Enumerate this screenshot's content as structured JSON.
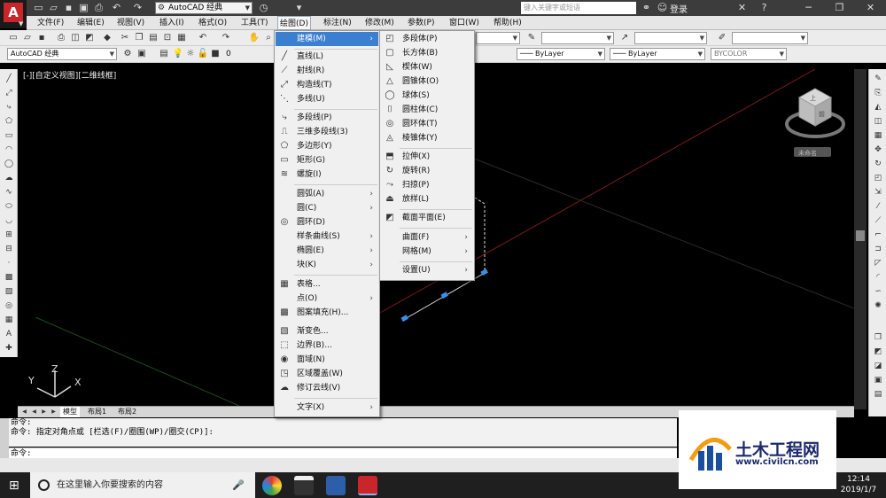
{
  "app": {
    "workspace": "AutoCAD 经典",
    "search_placeholder": "键入关键字或短语",
    "login": "登录"
  },
  "menubar": [
    "文件(F)",
    "编辑(E)",
    "视图(V)",
    "插入(I)",
    "格式(O)",
    "工具(T)",
    "绘图(D)",
    "标注(N)",
    "修改(M)",
    "参数(P)",
    "窗口(W)",
    "帮助(H)"
  ],
  "toolbar": {
    "workspace_combo": "AutoCAD 经典",
    "layer": "0",
    "linetype1": "ByLayer",
    "linetype2": "ByLayer",
    "color": "BYCOLOR"
  },
  "viewport": {
    "label": "[-][自定义视图][二维线框]",
    "viewcube_top": "上",
    "viewcube_front": "前",
    "unnamed": "未命名"
  },
  "draw_menu": {
    "items": [
      "建模(M)",
      "直线(L)",
      "射线(R)",
      "构造线(T)",
      "多线(U)",
      "多段线(P)",
      "三维多段线(3)",
      "多边形(Y)",
      "矩形(G)",
      "螺旋(I)",
      "圆弧(A)",
      "圆(C)",
      "圆环(D)",
      "样条曲线(S)",
      "椭圆(E)",
      "块(K)",
      "表格...",
      "点(O)",
      "图案填充(H)...",
      "渐变色...",
      "边界(B)...",
      "面域(N)",
      "区域覆盖(W)",
      "修订云线(V)",
      "文字(X)"
    ]
  },
  "modeling_menu": {
    "items": [
      "多段体(P)",
      "长方体(B)",
      "楔体(W)",
      "圆锥体(O)",
      "球体(S)",
      "圆柱体(C)",
      "圆环体(T)",
      "棱锥体(Y)",
      "拉伸(X)",
      "旋转(R)",
      "扫掠(P)",
      "放样(L)",
      "截面平面(E)",
      "曲面(F)",
      "网格(M)",
      "设置(U)"
    ]
  },
  "tabs": [
    "模型",
    "布局1",
    "布局2"
  ],
  "command": {
    "line1": "命令:",
    "line2": "命令: 指定对角点或 [栏选(F)/圈围(WP)/圈交(CP)]:",
    "prompt": "命令:"
  },
  "taskbar": {
    "search": "在这里输入你要搜索的内容",
    "time": "12:14",
    "date": "2019/1/7"
  },
  "watermark": {
    "name": "土木工程网",
    "url": "www.civilcn.com"
  },
  "colors": {
    "menu_highlight": "#3a7fd0",
    "brand_red": "#c8262a",
    "grip_blue": "#3a8ee6"
  }
}
